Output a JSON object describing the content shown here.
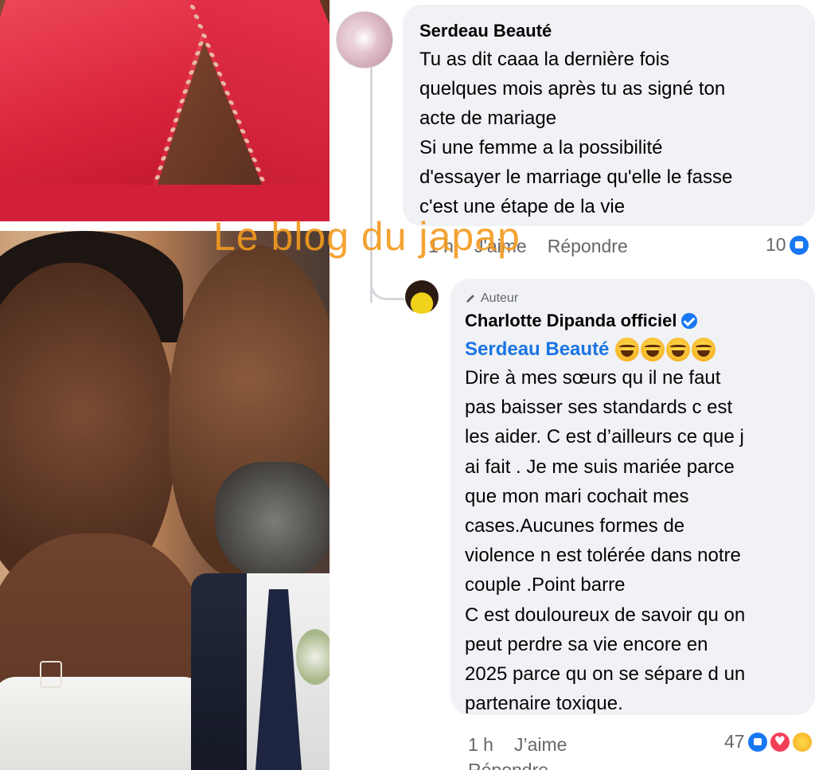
{
  "comment1": {
    "author": "Serdeau Beauté",
    "text": "Tu as dit caaa la dernière fois\nquelques mois après tu as signé ton\nacte de mariage\nSi une femme a la possibilité\nd'essayer le marriage qu'elle le fasse\nc'est une étape de la vie",
    "time": "1 h",
    "like_label": "J'aime",
    "reply_label": "Répondre",
    "reaction_count": "10"
  },
  "comment2": {
    "badge": "Auteur",
    "author": "Charlotte Dipanda officiel",
    "mention": "Serdeau Beauté",
    "text": "Dire à mes sœurs qu il ne faut\npas baisser ses standards c est\nles aider. C est d’ailleurs ce que j\nai fait . Je me suis mariée parce\nque mon mari cochait mes\ncases.Aucunes formes de\nviolence n est tolérée dans notre\ncouple .Point barre\nC est douloureux de savoir qu on\npeut perdre sa vie  encore en\n2025 parce qu on se sépare d un\npartenaire toxique.",
    "time": "1 h",
    "like_label": "J’aime",
    "reply_label": "Répondre",
    "reaction_count": "47"
  },
  "watermark": "Le blog du japap",
  "colors": {
    "bubble": "#f0f2f5",
    "mention": "#1b74e4",
    "meta": "#65676b",
    "watermark": "#f39a1e"
  }
}
